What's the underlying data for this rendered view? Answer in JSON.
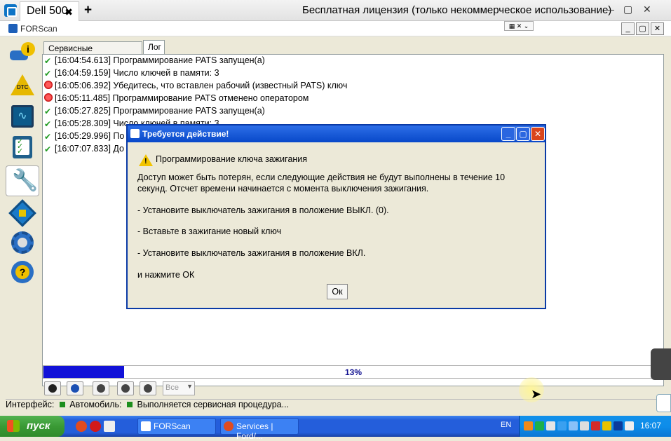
{
  "teamviewer": {
    "tab_label": "Dell 500",
    "tab_close": "✖",
    "add_tab": "+",
    "license_text": "Бесплатная лицензия (только некоммерческое использование)",
    "minimize": "—",
    "restore": "▢",
    "close": "✕"
  },
  "forscan": {
    "title": "FORScan",
    "tabs": [
      "Сервисные процедуры",
      "Лог"
    ],
    "active_tab": "Лог",
    "log": [
      {
        "status": "ok",
        "text": "[16:04:54.613] Программирование PATS запущен(а)"
      },
      {
        "status": "ok",
        "text": "[16:04:59.159] Число ключей в памяти: 3"
      },
      {
        "status": "error",
        "text": "[16:05:06.392] Убедитесь, что вставлен рабочий (известный PATS) ключ"
      },
      {
        "status": "error",
        "text": "[16:05:11.485] Программирование PATS отменено оператором"
      },
      {
        "status": "ok",
        "text": "[16:05:27.825] Программирование PATS запущен(а)"
      },
      {
        "status": "ok",
        "text": "[16:05:28.309] Число ключей в памяти: 3"
      },
      {
        "status": "ok",
        "text": "[16:05:29.996] По"
      },
      {
        "status": "ok",
        "text": "[16:07:07.833] До"
      }
    ],
    "progress_percent": 13,
    "progress_label": "13%",
    "filter_value": "Все",
    "status": {
      "interface_label": "Интерфейс:",
      "vehicle_label": "Автомобиль:",
      "state_text": "Выполняется сервисная процедура..."
    }
  },
  "dialog": {
    "title": "Требуется действие!",
    "heading": "Программирование ключа зажигания",
    "paragraph_1": "Доступ может быть потерян, если следующие действия не будут выполнены в течение 10 секунд. Отсчет времени начинается с момента выключения зажигания.",
    "step_1": "- Установите выключатель зажигания в положение ВЫКЛ. (0).",
    "step_2": "- Вставьте в зажигание новый ключ",
    "step_3": "- Установите выключатель зажигания в положение ВКЛ.",
    "prompt": "и нажмите ОК",
    "ok_button": "Ок"
  },
  "taskbar": {
    "start_label": "пуск",
    "tasks": [
      "FORScan",
      "Services | Ford/..."
    ],
    "language": "EN",
    "clock": "16:07"
  }
}
